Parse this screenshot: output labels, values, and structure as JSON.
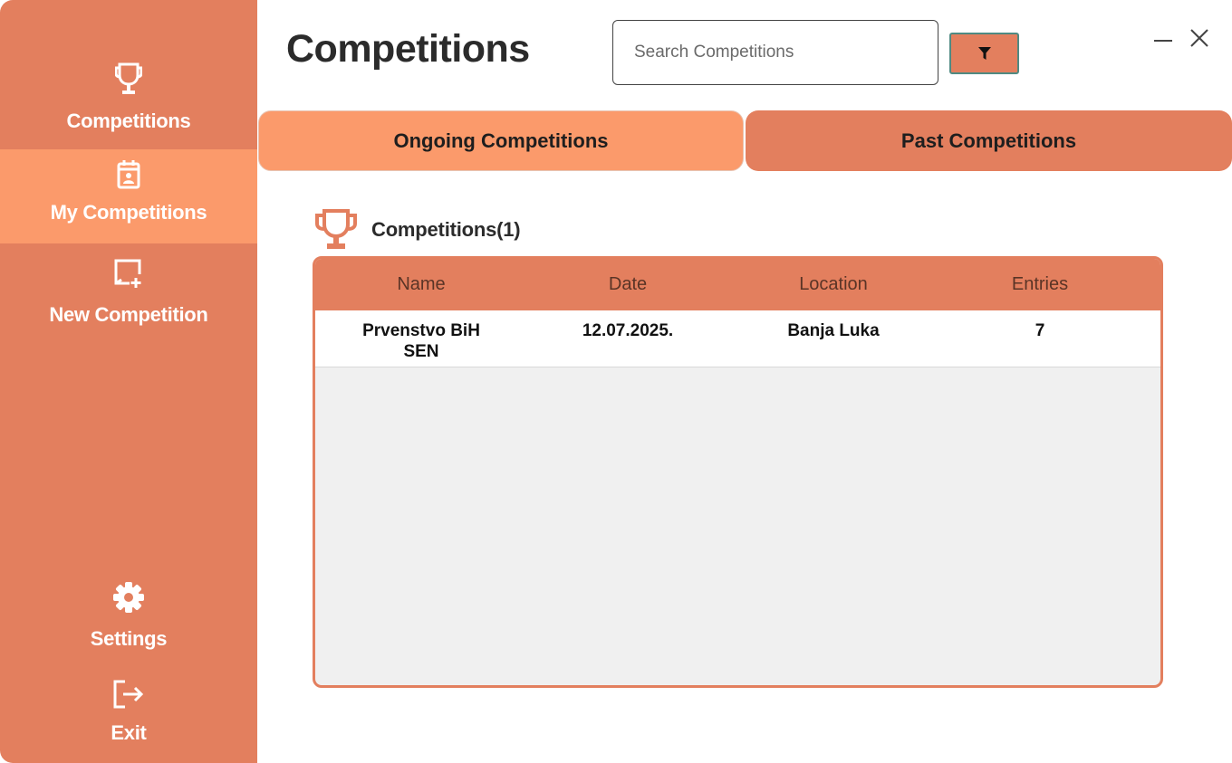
{
  "sidebar": {
    "items": [
      {
        "label": "Competitions",
        "icon": "trophy-icon"
      },
      {
        "label": "My Competitions",
        "icon": "calendar-user-icon"
      },
      {
        "label": "New Competition",
        "icon": "add-board-icon"
      },
      {
        "label": "Settings",
        "icon": "gear-icon"
      },
      {
        "label": "Exit",
        "icon": "exit-icon"
      }
    ]
  },
  "header": {
    "title": "Competitions",
    "search_placeholder": "Search Competitions",
    "search_value": ""
  },
  "tabs": [
    {
      "label": "Ongoing Competitions",
      "selected": true
    },
    {
      "label": "Past Competitions",
      "selected": false
    }
  ],
  "section": {
    "title": "Competitions(1)"
  },
  "table": {
    "columns": [
      "Name",
      "Date",
      "Location",
      "Entries"
    ],
    "rows": [
      {
        "name": "Prvenstvo BiH SEN",
        "date": "12.07.2025.",
        "location": "Banja Luka",
        "entries": "7"
      }
    ]
  },
  "colors": {
    "sidebar": "#E37F5E",
    "active": "#FB9A6B",
    "table_body": "#F0F0F0"
  }
}
